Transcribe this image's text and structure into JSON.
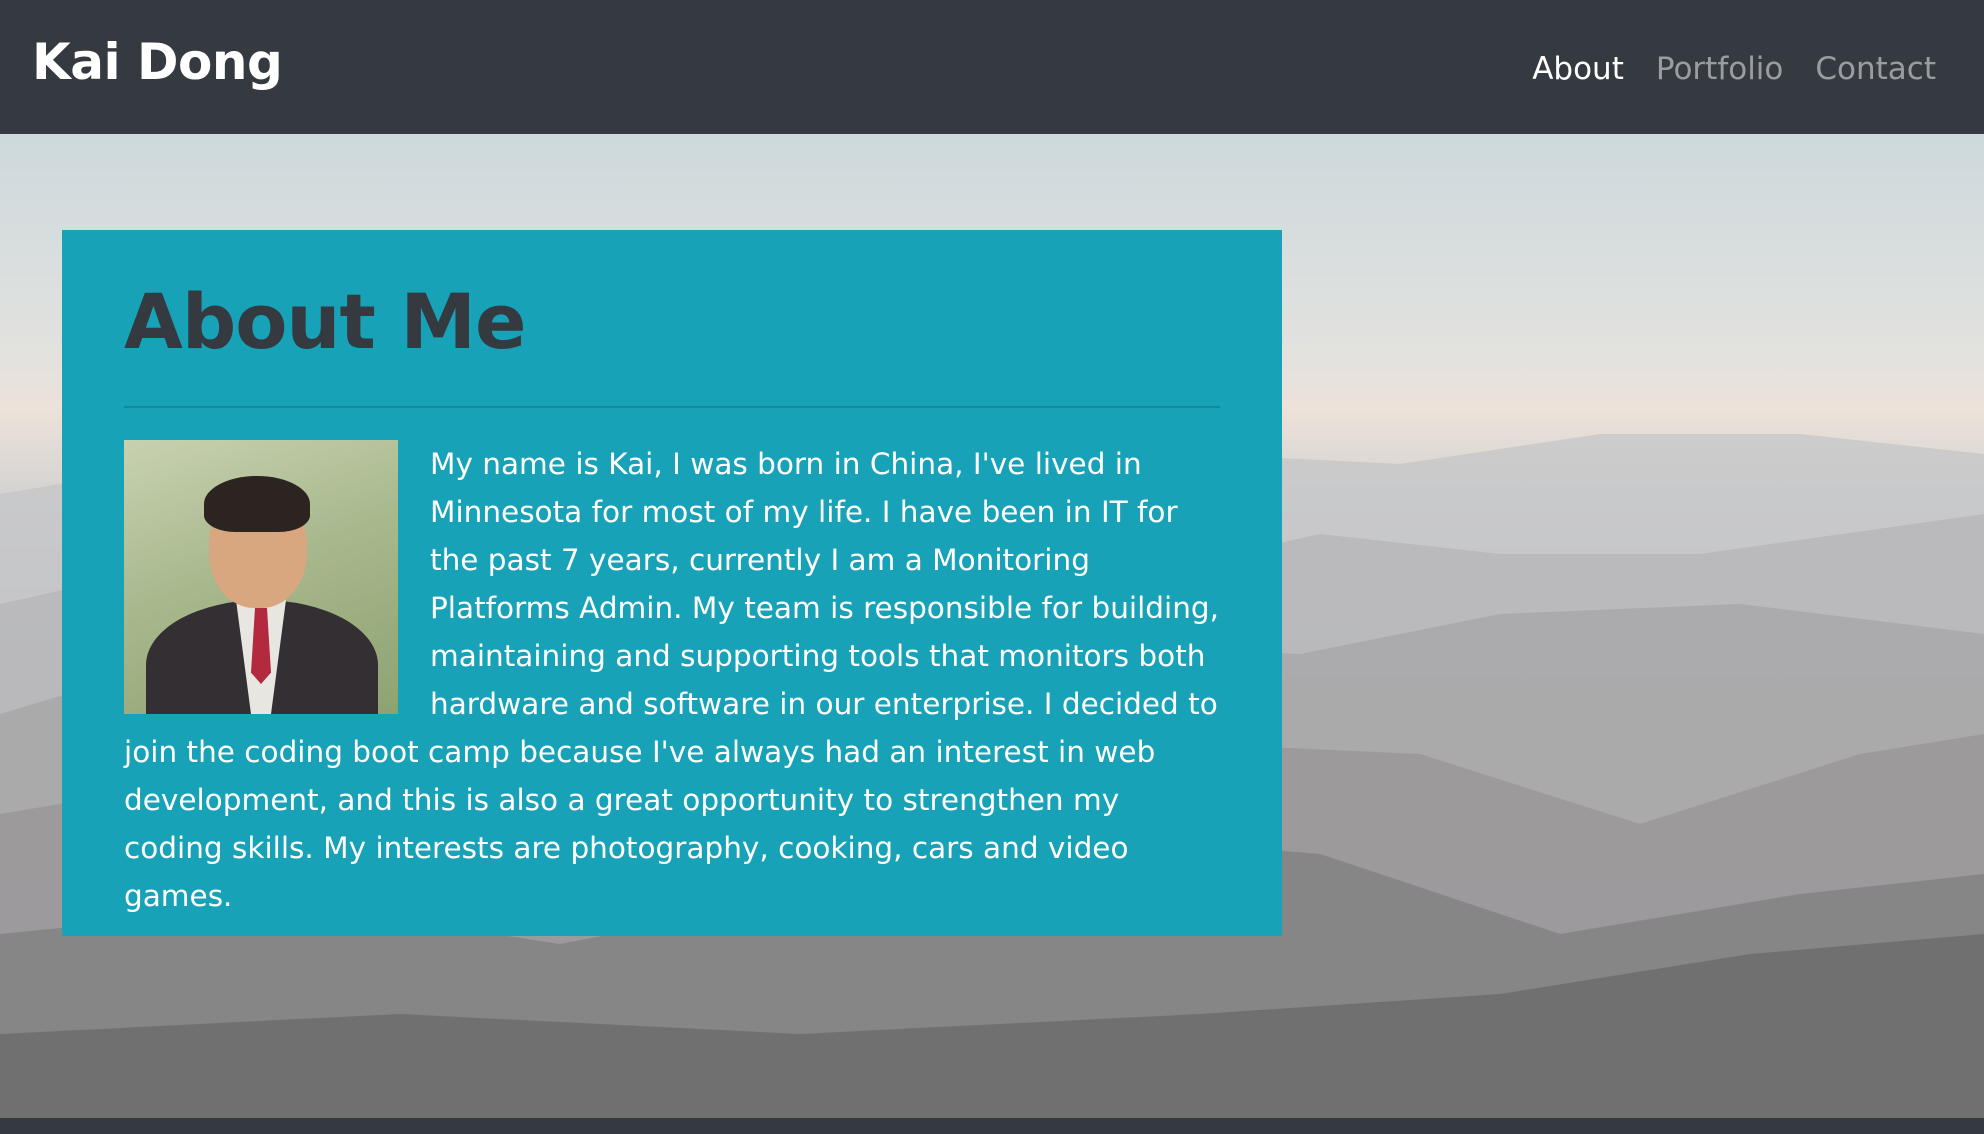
{
  "navbar": {
    "brand": "Kai Dong",
    "links": [
      {
        "label": "About",
        "active": true
      },
      {
        "label": "Portfolio",
        "active": false
      },
      {
        "label": "Contact",
        "active": false
      }
    ]
  },
  "about": {
    "heading": "About Me",
    "paragraph": "My name is Kai, I was born in China, I've lived in Minnesota for most of my life. I have been in IT for the past 7 years, currently I am a Monitoring Platforms Admin. My team is responsible for building, maintaining and supporting tools that monitors both hardware and software in our enterprise. I decided to join the coding boot camp because I've always had an interest in web development, and this is also a great opportunity to strengthen my coding skills. My interests are photography, cooking, cars and video games."
  },
  "colors": {
    "navbar_bg": "#343a40",
    "card_bg": "#17a2b8",
    "heading": "#343a40",
    "text": "#ffffff"
  }
}
